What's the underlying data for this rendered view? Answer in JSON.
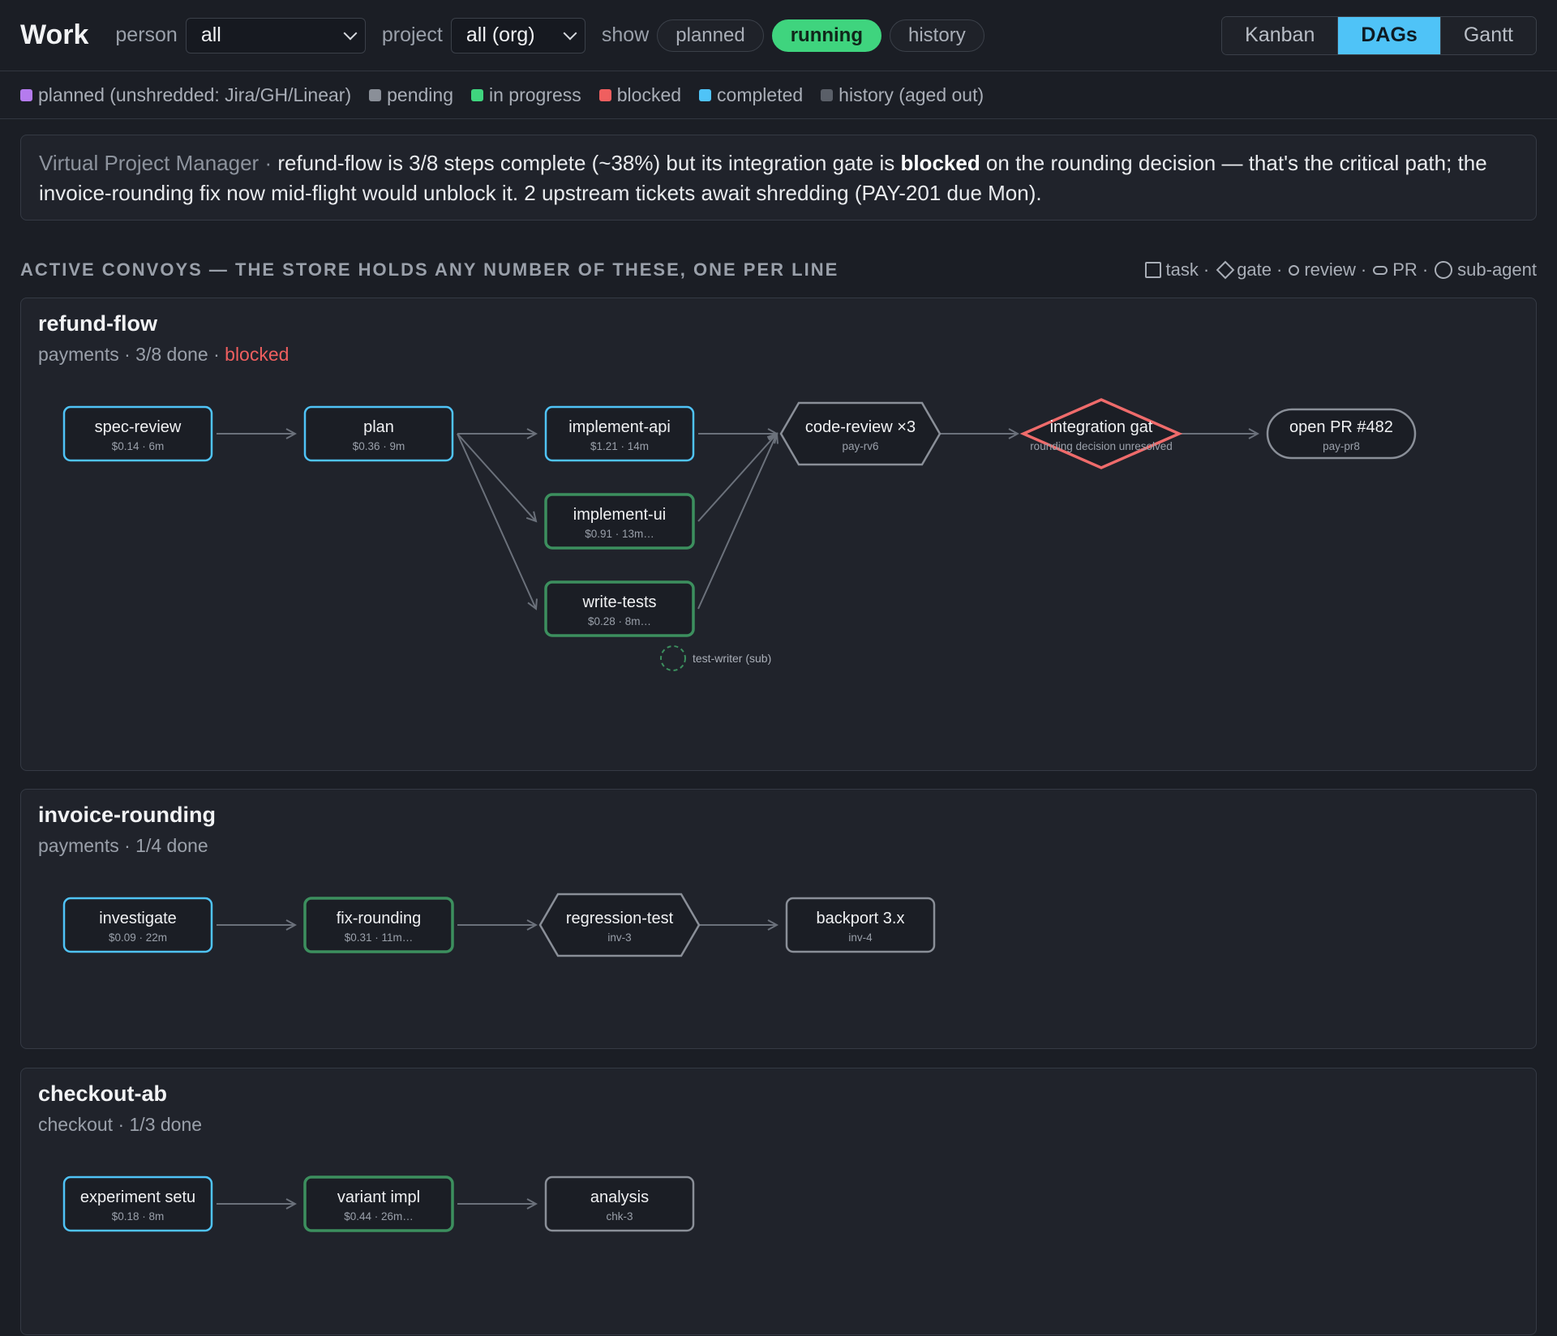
{
  "header": {
    "title": "Work",
    "person_label": "person",
    "person_value": "all",
    "project_label": "project",
    "project_value": "all (org)",
    "show_label": "show",
    "show_pills": [
      {
        "label": "planned",
        "active": false
      },
      {
        "label": "running",
        "active": true
      },
      {
        "label": "history",
        "active": false
      }
    ],
    "views": [
      {
        "label": "Kanban",
        "active": false
      },
      {
        "label": "DAGs",
        "active": true
      },
      {
        "label": "Gantt",
        "active": false
      }
    ]
  },
  "status_legend": [
    {
      "label": "planned (unshredded: Jira/GH/Linear)",
      "color": "#b57bee"
    },
    {
      "label": "pending",
      "color": "#8a8f98"
    },
    {
      "label": "in progress",
      "color": "#3fd47e"
    },
    {
      "label": "blocked",
      "color": "#ef5f5f"
    },
    {
      "label": "completed",
      "color": "#4fc3f7"
    },
    {
      "label": "history (aged out)",
      "color": "#5a5f68"
    }
  ],
  "summary": {
    "source": "Virtual Project Manager",
    "sep": " · ",
    "text_before": "refund-flow is 3/8 steps complete (~38%) but its integration gate is ",
    "bold": "blocked",
    "text_after": " on the rounding decision — that's the critical path; the invoice-rounding fix now mid-flight would unblock it. 2 upstream tickets await shredding (PAY-201 due Mon)."
  },
  "section_title": "ACTIVE CONVOYS — THE STORE HOLDS ANY NUMBER OF THESE, ONE PER LINE",
  "shape_legend": [
    {
      "icon": "task-icon",
      "label": "task"
    },
    {
      "icon": "gate-icon",
      "label": "gate"
    },
    {
      "icon": "review-icon",
      "label": "review"
    },
    {
      "icon": "pr-icon",
      "label": "PR"
    },
    {
      "icon": "sub-agent-icon",
      "label": "sub-agent"
    }
  ],
  "colors": {
    "completed": "#4fc3f7",
    "in_progress": "#3c8f5e",
    "blocked": "#ef6b6b",
    "pending": "#8a8f98",
    "edge": "#6b717b"
  },
  "convoys": [
    {
      "id": "refund-flow",
      "name": "refund-flow",
      "project": "payments",
      "progress": "3/8 done",
      "status_text": "blocked",
      "nodes": [
        {
          "id": "spec",
          "shape": "task",
          "status": "completed",
          "label": "spec-review",
          "sub": "$0.14 · 6m"
        },
        {
          "id": "plan",
          "shape": "task",
          "status": "completed",
          "label": "plan",
          "sub": "$0.36 · 9m"
        },
        {
          "id": "api",
          "shape": "task",
          "status": "completed",
          "label": "implement-api",
          "sub": "$1.21 · 14m"
        },
        {
          "id": "ui",
          "shape": "task",
          "status": "in_progress",
          "label": "implement-ui",
          "sub": "$0.91 · 13m…"
        },
        {
          "id": "tests",
          "shape": "task",
          "status": "in_progress",
          "label": "write-tests",
          "sub": "$0.28 · 8m…"
        },
        {
          "id": "review",
          "shape": "review",
          "status": "pending",
          "label": "code-review ×3",
          "sub": "pay-rv6"
        },
        {
          "id": "gate",
          "shape": "gate",
          "status": "blocked",
          "label": "integration gat",
          "sub": "rounding decision unresolved"
        },
        {
          "id": "pr",
          "shape": "pr",
          "status": "pending",
          "label": "open PR #482",
          "sub": "pay-pr8"
        }
      ],
      "subagents": [
        {
          "parent": "tests",
          "label": "test-writer (sub)"
        }
      ]
    },
    {
      "id": "invoice-rounding",
      "name": "invoice-rounding",
      "project": "payments",
      "progress": "1/4 done",
      "status_text": "",
      "nodes": [
        {
          "id": "inv1",
          "shape": "task",
          "status": "completed",
          "label": "investigate",
          "sub": "$0.09 · 22m"
        },
        {
          "id": "inv2",
          "shape": "task",
          "status": "in_progress",
          "label": "fix-rounding",
          "sub": "$0.31 · 11m…"
        },
        {
          "id": "inv3",
          "shape": "review",
          "status": "pending",
          "label": "regression-test",
          "sub": "inv-3"
        },
        {
          "id": "inv4",
          "shape": "task",
          "status": "pending",
          "label": "backport 3.x",
          "sub": "inv-4"
        }
      ],
      "subagents": []
    },
    {
      "id": "checkout-ab",
      "name": "checkout-ab",
      "project": "checkout",
      "progress": "1/3 done",
      "status_text": "",
      "nodes": [
        {
          "id": "chk1",
          "shape": "task",
          "status": "completed",
          "label": "experiment setu",
          "sub": "$0.18 · 8m"
        },
        {
          "id": "chk2",
          "shape": "task",
          "status": "in_progress",
          "label": "variant impl",
          "sub": "$0.44 · 26m…"
        },
        {
          "id": "chk3",
          "shape": "task",
          "status": "pending",
          "label": "analysis",
          "sub": "chk-3"
        }
      ],
      "subagents": []
    }
  ]
}
